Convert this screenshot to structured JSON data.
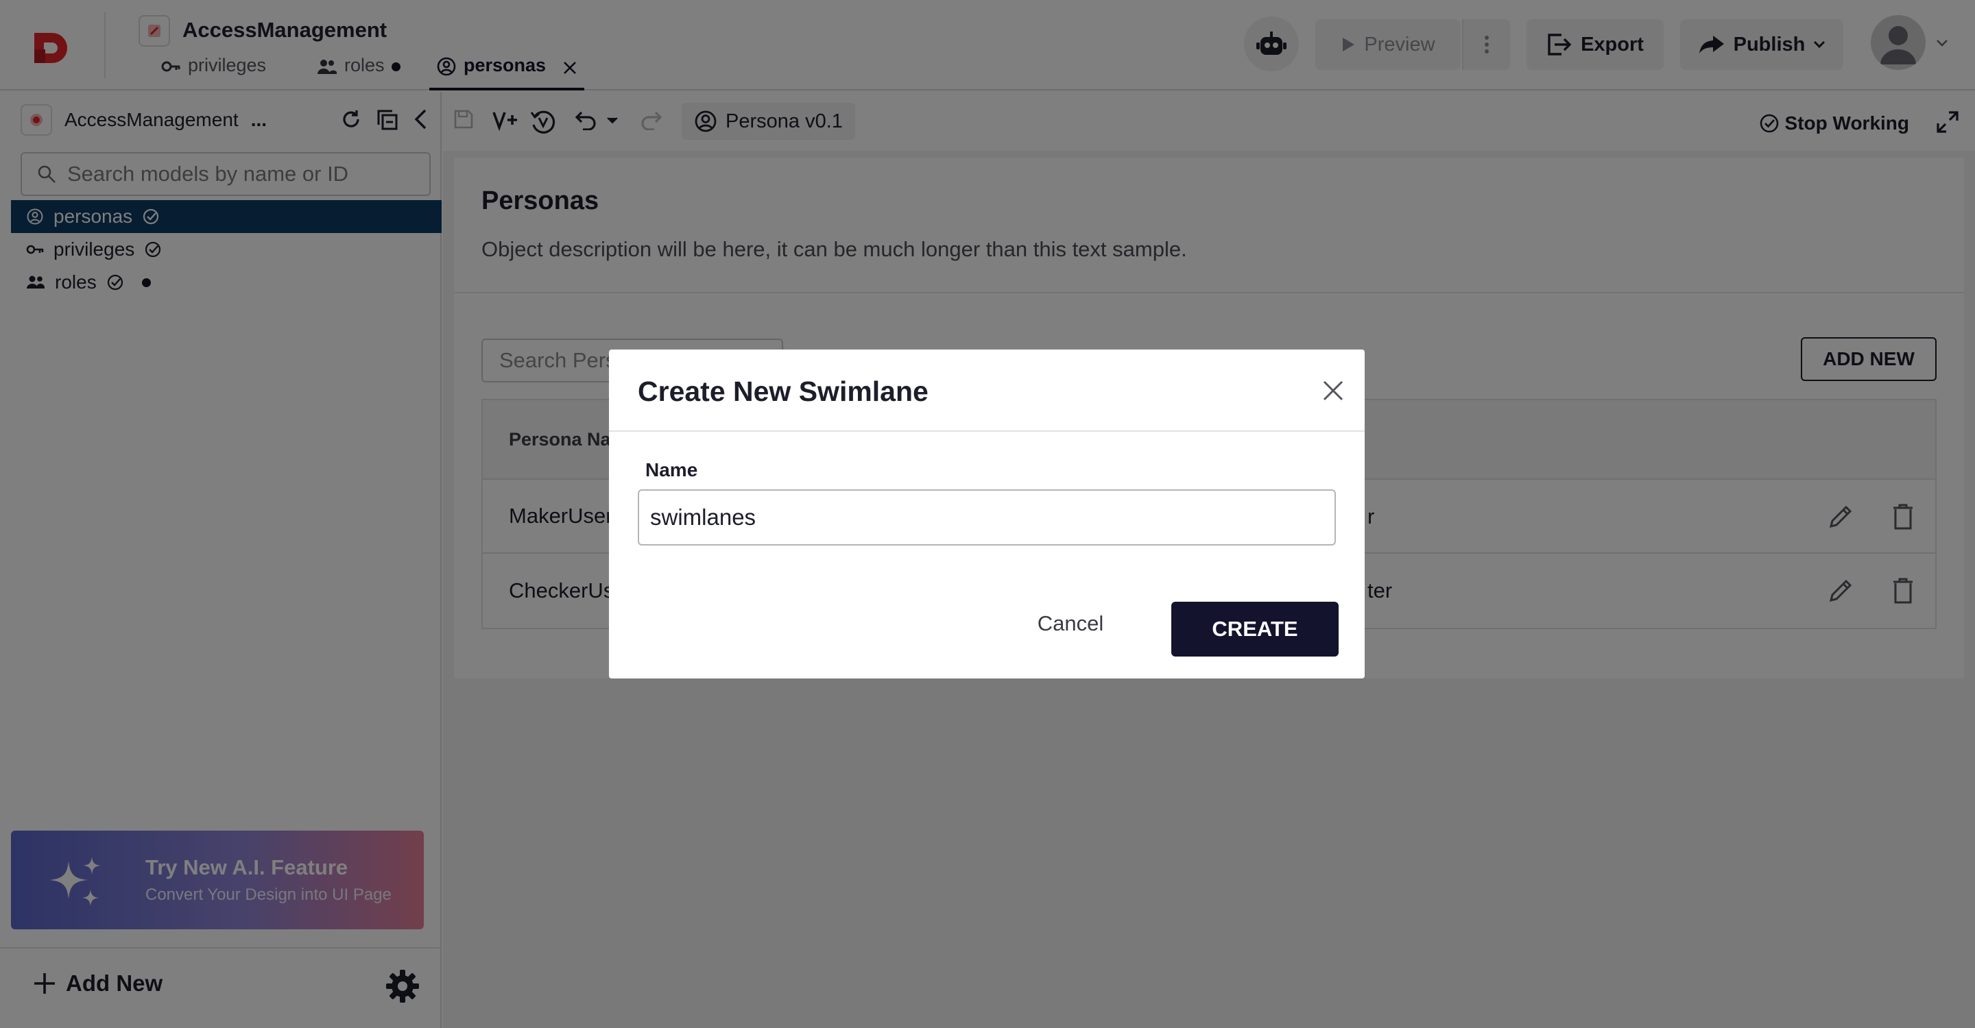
{
  "header": {
    "app_title": "AccessManagement",
    "tabs": [
      {
        "label": "privileges",
        "icon": "key-icon"
      },
      {
        "label": "roles",
        "icon": "people-icon",
        "unsaved": true
      },
      {
        "label": "personas",
        "icon": "person-circle-icon",
        "active": true
      }
    ],
    "preview_label": "Preview",
    "export_label": "Export",
    "publish_label": "Publish"
  },
  "sidebar": {
    "project_name": "AccessManagement",
    "project_more": "...",
    "search_placeholder": "Search models by name or ID",
    "items": [
      {
        "label": "personas",
        "selected": true
      },
      {
        "label": "privileges"
      },
      {
        "label": "roles",
        "unsaved": true
      }
    ],
    "ai_banner": {
      "title": "Try New A.I. Feature",
      "subtitle": "Convert Your Design into UI Page"
    },
    "add_new_label": "Add New"
  },
  "toolbar": {
    "version_label": "Persona v0.1",
    "stop_working_label": "Stop Working"
  },
  "main": {
    "title": "Personas",
    "description": "Object description will be here, it can be much longer than this text sample.",
    "search_placeholder": "Search Personas",
    "add_new_label": "ADD NEW",
    "table": {
      "header": "Persona Name",
      "rows": [
        {
          "name": "MakerUser",
          "desc_tail": "r"
        },
        {
          "name": "CheckerUser",
          "desc_tail": "ter"
        }
      ]
    }
  },
  "modal": {
    "title": "Create New Swimlane",
    "field_label": "Name",
    "field_value": "swimlanes",
    "cancel_label": "Cancel",
    "create_label": "CREATE"
  },
  "colors": {
    "brand_red": "#e3242b",
    "navy": "#14132e",
    "selection": "#0f3a63",
    "overlay": "rgba(0,0,0,0.5)"
  }
}
